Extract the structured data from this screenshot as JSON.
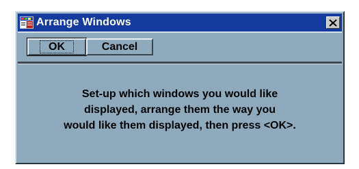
{
  "window": {
    "title": "Arrange Windows",
    "app_icon": "arrange-windows-app-icon",
    "close_icon": "close-x-icon"
  },
  "buttons": {
    "ok_label": "OK",
    "cancel_label": "Cancel"
  },
  "message": {
    "lines": [
      "Set-up which windows you would like",
      "displayed, arrange them the way you",
      "would like them displayed, then press <OK>."
    ]
  },
  "colors": {
    "title_bar": "#133a9c",
    "dialog_background": "#8fa9bd",
    "text": "#000000"
  }
}
